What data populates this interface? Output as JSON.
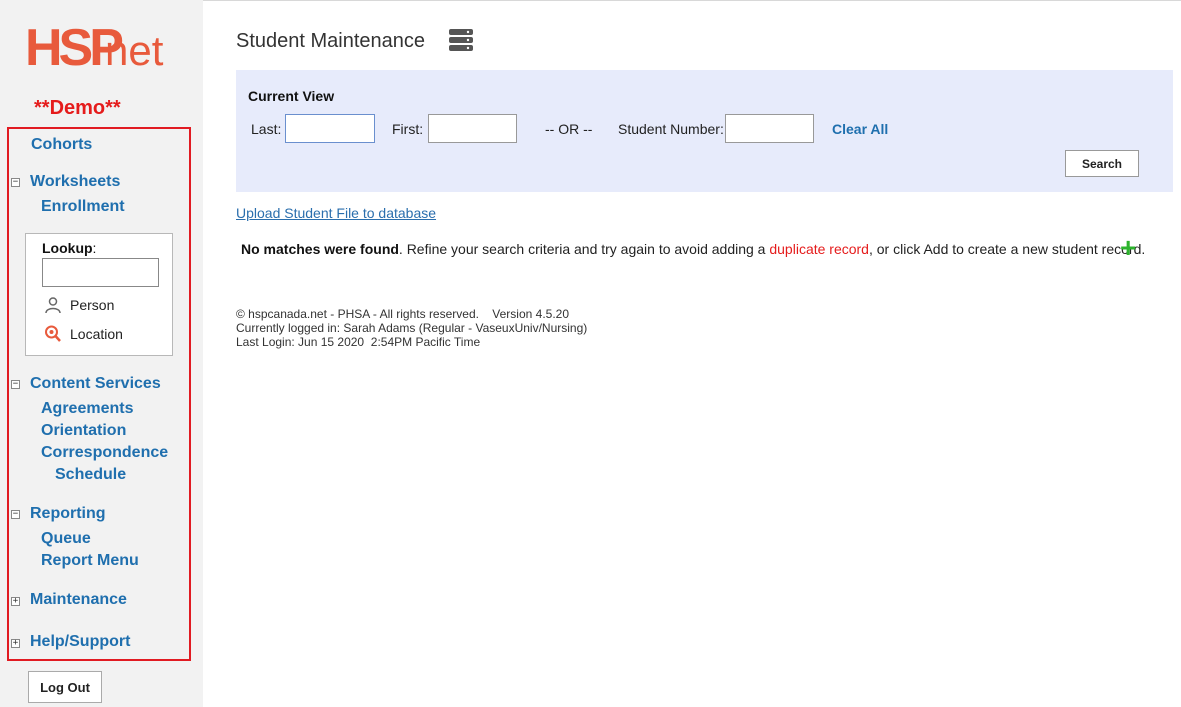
{
  "sidebar": {
    "logo_left": "HSP",
    "logo_right": "net",
    "demo_label": "**Demo**",
    "items": {
      "cohorts": "Cohorts",
      "worksheets": "Worksheets",
      "enrollment": "Enrollment",
      "content_services": "Content Services",
      "agreements": "Agreements",
      "orientation": "Orientation",
      "correspondence": "Correspondence",
      "schedule": "Schedule",
      "reporting": "Reporting",
      "queue": "Queue",
      "report_menu": "Report Menu",
      "maintenance": "Maintenance",
      "help_support": "Help/Support"
    },
    "toggles": {
      "worksheets": "−",
      "content_services": "−",
      "reporting": "−",
      "maintenance": "+",
      "help_support": "+"
    },
    "lookup": {
      "title": "Lookup",
      "title_suffix": ":",
      "input_value": "",
      "person": "Person",
      "location": "Location"
    },
    "logout_label": "Log Out"
  },
  "header": {
    "title": "Student Maintenance",
    "icon": "database-icon"
  },
  "search": {
    "panel_title": "Current View",
    "last_label": "Last:",
    "last_value": "",
    "first_label": "First:",
    "first_value": "",
    "or_label": "-- OR --",
    "student_number_label": "Student Number:",
    "student_number_value": "",
    "clear_all": "Clear All",
    "search_button": "Search"
  },
  "upload_link": "Upload Student File to database",
  "message": {
    "bold": "No matches were found",
    "part1": ". Refine your search criteria and try again to avoid adding a ",
    "duplicate": "duplicate record",
    "part2": ", or click Add to create a new student record.",
    "add_symbol": "+"
  },
  "footer": {
    "line1": "© hspcanada.net - PHSA - All rights reserved.    Version 4.5.20",
    "line2": "Currently logged in: Sarah Adams (Regular - VaseuxUniv/Nursing)",
    "line3": "Last Login: Jun 15 2020  2:54PM Pacific Time"
  },
  "colors": {
    "brand": "#e85a3c",
    "link": "#1f6fae",
    "highlight_box": "#e11b22",
    "panel_bg": "#e7ebfb",
    "add_green": "#2db32d"
  }
}
